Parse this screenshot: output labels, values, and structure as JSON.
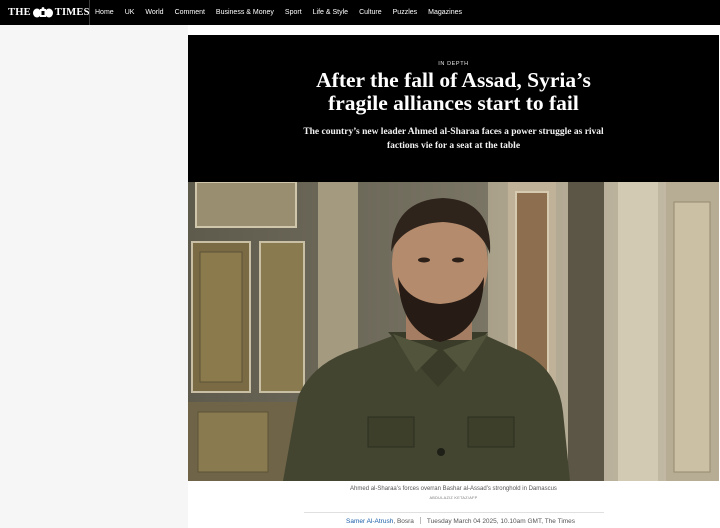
{
  "nav": {
    "logo_left": "THE",
    "logo_right": "TIMES",
    "links": [
      "Home",
      "UK",
      "World",
      "Comment",
      "Business & Money",
      "Sport",
      "Life & Style",
      "Culture",
      "Puzzles",
      "Magazines"
    ]
  },
  "article": {
    "kicker": "IN DEPTH",
    "headline_line1": "After the fall of Assad, Syria’s",
    "headline_line2": "fragile alliances start to fail",
    "standfirst_line1": "The country’s new leader Ahmed al-Sharaa faces a power struggle as rival",
    "standfirst_line2": "factions vie for a seat at the table",
    "caption": "Ahmed al-Sharaa’s forces overran Bashar al-Assad’s stronghold in Damascus",
    "credit": "ABDULAZIZ KETAZ/AFP",
    "author": "Samer Al-Atrush",
    "location": ", Bosra",
    "published": "Tuesday March 04 2025, 10.10am GMT, The Times"
  },
  "colors": {
    "nav_background": "#000000",
    "hero_background": "#000000",
    "author_link": "#1a5ea8"
  }
}
